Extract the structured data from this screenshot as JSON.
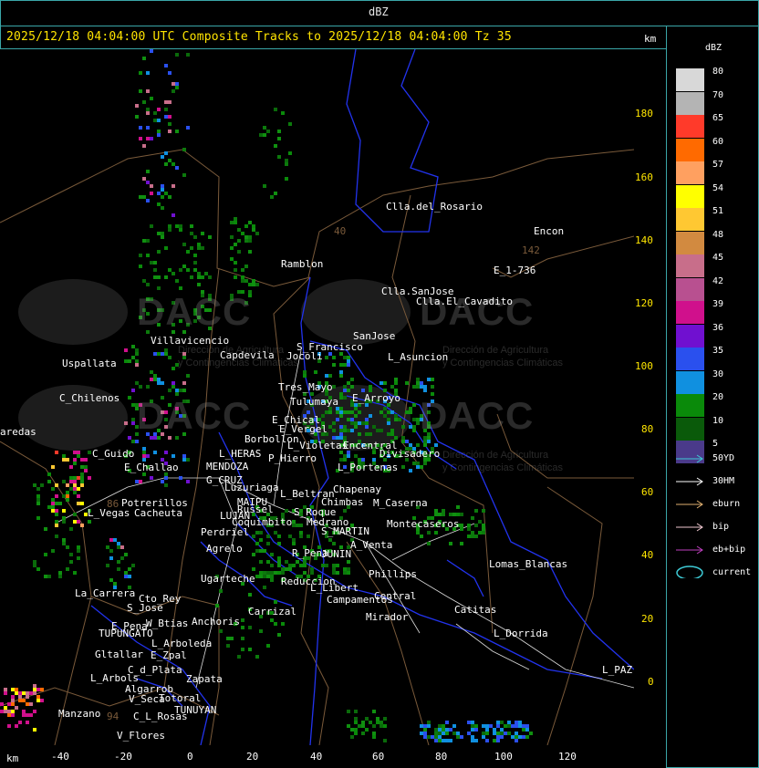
{
  "top_unit": "dBZ",
  "title": "2025/12/18 04:04:00 UTC Composite Tracks to 2025/12/18 04:04:00 Tz 35",
  "km_top": "km",
  "km_bottom": "km",
  "y_ticks": [
    "180",
    "160",
    "140",
    "120",
    "100",
    "80",
    "60",
    "40",
    "20",
    "0"
  ],
  "x_ticks": [
    "-40",
    "-20",
    "0",
    "20",
    "40",
    "60",
    "80",
    "100",
    "120"
  ],
  "legend": {
    "title": "dBZ",
    "scale": [
      {
        "label": "80",
        "color": "#d8d8d8"
      },
      {
        "label": "70",
        "color": "#b4b4b4"
      },
      {
        "label": "65",
        "color": "#ff3a2a"
      },
      {
        "label": "60",
        "color": "#ff6a00"
      },
      {
        "label": "57",
        "color": "#ffa060"
      },
      {
        "label": "54",
        "color": "#ffff00"
      },
      {
        "label": "51",
        "color": "#ffc832"
      },
      {
        "label": "48",
        "color": "#d28a40"
      },
      {
        "label": "45",
        "color": "#c86e8a"
      },
      {
        "label": "42",
        "color": "#b85090"
      },
      {
        "label": "39",
        "color": "#d0108c"
      },
      {
        "label": "36",
        "color": "#7010d0"
      },
      {
        "label": "35",
        "color": "#2a50ee"
      },
      {
        "label": "30",
        "color": "#1090e0"
      },
      {
        "label": "20",
        "color": "#0a8a0a"
      },
      {
        "label": "10",
        "color": "#0a5a0a"
      },
      {
        "label": "5",
        "color": "#4a3a8a"
      }
    ],
    "tracks": [
      {
        "label": "50YD",
        "color": "#3ecbd6"
      },
      {
        "label": "30HM",
        "color": "#ffffff"
      },
      {
        "label": "eburn",
        "color": "#e0b070"
      },
      {
        "label": "bip",
        "color": "#f0c8d0"
      },
      {
        "label": "eb+bip",
        "color": "#c040c0"
      },
      {
        "label": "current",
        "color": "#3ecbd6"
      }
    ]
  },
  "watermark": {
    "brand": "DACC",
    "line1": "Dirección de Agricultura",
    "line2": "y Contingencias Climáticas"
  },
  "places": [
    "Clla.del_Rosario",
    "Encon",
    "E_1-736",
    "Ramblon",
    "Clla.SanJose",
    "Clla.El_Cavadito",
    "S_Francisco",
    "SanJose",
    "L_Asuncion",
    "Villavicencio",
    "Capdevila",
    "Jocoli",
    "Uspallata",
    "Tres_Mayo",
    "E_Arroyo",
    "C_Chilenos",
    "Tulumaya",
    "E_Chical",
    "E_Vergel",
    "Borbollon",
    "L_Violetas",
    "Encentral",
    "Divisadero",
    "L_HERAS",
    "P_Hierro",
    "C_Guido",
    "E_Challao",
    "MENDOZA",
    "G_CRUZ",
    "L_Portenas",
    "Chapenay",
    "Luzuriaga",
    "L_Beltran",
    "Chimbas",
    "Potrerillos",
    "MAIPU",
    "M_Caserna",
    "L_Vegas",
    "Cacheuta",
    "LUJAN",
    "Russel",
    "Coquimbito",
    "S_Roque",
    "Medrano",
    "Perdriel",
    "S_MARTIN",
    "Agrelo",
    "A_Venta",
    "JUNIN",
    "R_Pena",
    "Ugarteche",
    "Lomas_Blancas",
    "Phillips",
    "Reduccion",
    "La_Carrera",
    "Cto_Rey",
    "S_Jose",
    "L_Libert",
    "Campamentos",
    "Central",
    "Carrizal",
    "Catitas",
    "Anchoris",
    "W_Btias",
    "E_Pena",
    "TUPUNGATO",
    "L_Dorrida",
    "Mirador",
    "L_Arboleda",
    "E_Zpal",
    "Gltallar",
    "C_d_Plata",
    "L_Arbols",
    "Zapata",
    "L_PAZ",
    "Algarrob",
    "V_Seca",
    "Totoral",
    "TUNUYAN",
    "Manzano",
    "C_L_Rosas",
    "V_Flores",
    "aredas",
    "Montecaseros",
    "142",
    "40",
    "94",
    "86"
  ]
}
